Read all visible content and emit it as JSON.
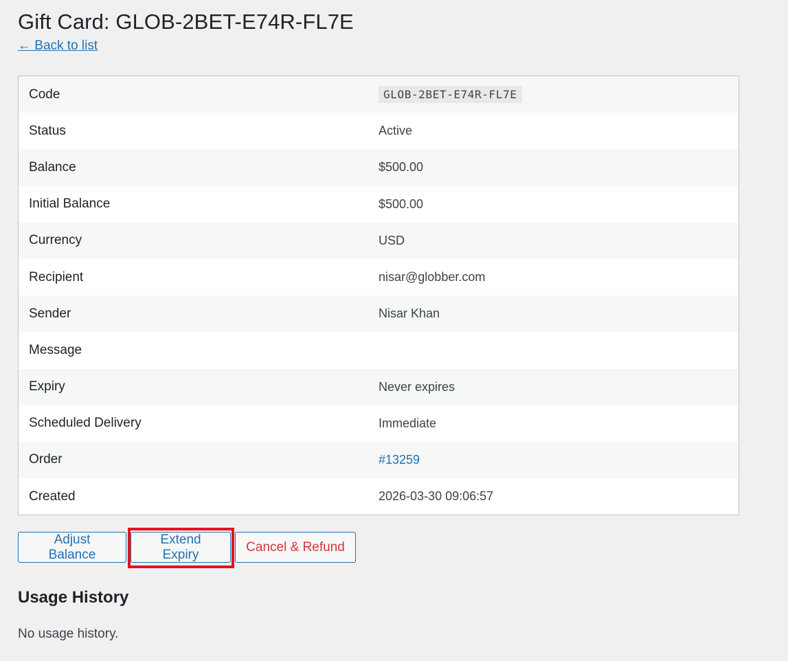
{
  "page": {
    "title": "Gift Card: GLOB-2BET-E74R-FL7E",
    "back_link": "← Back to list"
  },
  "details": [
    {
      "label": "Code",
      "value": "GLOB-2BET-E74R-FL7E"
    },
    {
      "label": "Status",
      "value": "Active"
    },
    {
      "label": "Balance",
      "value": "$500.00"
    },
    {
      "label": "Initial Balance",
      "value": "$500.00"
    },
    {
      "label": "Currency",
      "value": "USD"
    },
    {
      "label": "Recipient",
      "value": "nisar@globber.com"
    },
    {
      "label": "Sender",
      "value": "Nisar Khan"
    },
    {
      "label": "Message",
      "value": ""
    },
    {
      "label": "Expiry",
      "value": "Never expires"
    },
    {
      "label": "Scheduled Delivery",
      "value": "Immediate"
    },
    {
      "label": "Order",
      "value": "#13259"
    },
    {
      "label": "Created",
      "value": "2026-03-30 09:06:57"
    }
  ],
  "actions": {
    "adjust_balance": "Adjust Balance",
    "extend_expiry": "Extend Expiry",
    "cancel_refund": "Cancel & Refund"
  },
  "usage": {
    "title": "Usage History",
    "empty_text": "No usage history."
  },
  "colors": {
    "link": "#2271b1",
    "danger": "#d63638",
    "highlight": "#e1151f",
    "background": "#f0f0f1"
  }
}
